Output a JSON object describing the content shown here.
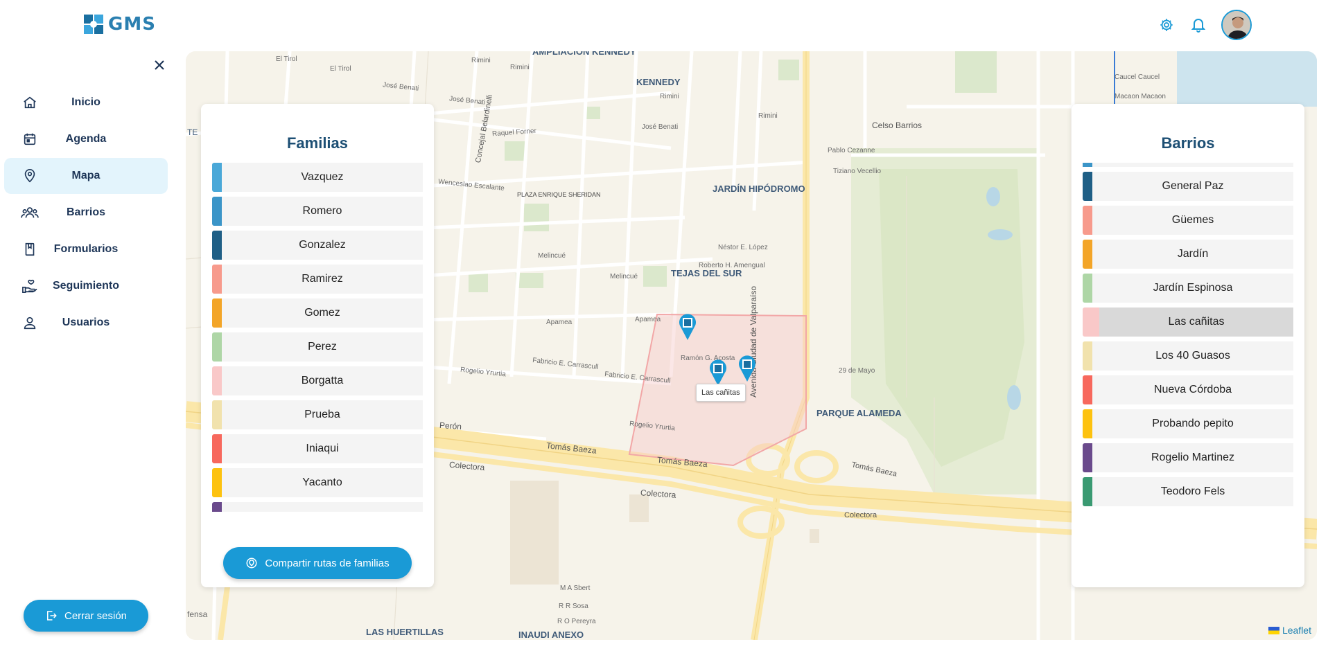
{
  "header": {
    "logo_text": "GMS",
    "settings_icon": "gear-icon",
    "notifications_icon": "bell-icon"
  },
  "sidebar": {
    "items": [
      {
        "label": "Inicio",
        "icon": "home-icon",
        "active": false
      },
      {
        "label": "Agenda",
        "icon": "calendar-icon",
        "active": false
      },
      {
        "label": "Mapa",
        "icon": "map-pin-icon",
        "active": true
      },
      {
        "label": "Barrios",
        "icon": "people-icon",
        "active": false
      },
      {
        "label": "Formularios",
        "icon": "form-icon",
        "active": false
      },
      {
        "label": "Seguimiento",
        "icon": "hand-heart-icon",
        "active": false
      },
      {
        "label": "Usuarios",
        "icon": "user-icon",
        "active": false
      }
    ],
    "logout_label": "Cerrar sesión"
  },
  "map": {
    "labels": {
      "ampliacion_kennedy": "AMPLIACIÓN KENNEDY",
      "kennedy": "KENNEDY",
      "jardin_hipodromo": "JARDÍN HIPÓDROMO",
      "tejas_del_sur": "TEJAS DEL SUR",
      "parque_alameda": "PARQUE ALAMEDA",
      "las_huertillas": "LAS HUERTILLAS",
      "inaudi_anexo": "INAUDI ANEXO",
      "plaza": "PLAZA ENRIQUE SHERIDAN",
      "celso_barrios": "Celso Barrios",
      "tomas_baeza": "Tomás Baeza",
      "colectora": "Colectora",
      "avenida": "Avenida Ciudad de Valparaíso",
      "peron": "Perón",
      "rimini": "Rimini",
      "jose_benati": "José Benati",
      "raquel_forner": "Raquel Forner",
      "wenceslao": "Wenceslao Escalante",
      "melincue": "Melincué",
      "apamea": "Apamea",
      "rogelio_yrurtia": "Rogelio Yrurtia",
      "fabricio": "Fabricio E. Carrascull",
      "ramon_acosta": "Ramón G. Acosta",
      "nestor_lopez": "Néstor E. López",
      "roberto_amengual": "Roberto H. Amengual",
      "pablo_cezanne": "Pablo Cezanne",
      "tiziano_vecellio": "Tiziano Vecellio",
      "mayo": "29 de Mayo",
      "caucel": "Caucel Caucel",
      "macaon": "Macaon Macaon",
      "el_tirol": "El Tirol",
      "concejal": "Concejal Belardinelli",
      "sbert": "M A Sbert",
      "sosa": "R R Sosa",
      "pereyra": "R O Pereyra",
      "fensa": "fensa",
      "te": "TE"
    },
    "tooltip": "Las cañitas",
    "attribution": "Leaflet"
  },
  "familias": {
    "title": "Familias",
    "items": [
      {
        "label": "Vazquez",
        "color": "#4aa8d8"
      },
      {
        "label": "Romero",
        "color": "#3b95c8"
      },
      {
        "label": "Gonzalez",
        "color": "#1f5f86"
      },
      {
        "label": "Ramirez",
        "color": "#f79a8c"
      },
      {
        "label": "Gomez",
        "color": "#f3a528"
      },
      {
        "label": "Perez",
        "color": "#aed6a6"
      },
      {
        "label": "Borgatta",
        "color": "#f9c8c8"
      },
      {
        "label": "Prueba",
        "color": "#f1e2ad"
      },
      {
        "label": "Iniaqui",
        "color": "#f7685d"
      },
      {
        "label": "Yacanto",
        "color": "#fdc20f"
      }
    ],
    "share_button": "Compartir rutas de familias"
  },
  "barrios": {
    "title": "Barrios",
    "items": [
      {
        "label": "General Paz",
        "color": "#1f5f86",
        "selected": false
      },
      {
        "label": "Güemes",
        "color": "#f79a8c",
        "selected": false
      },
      {
        "label": "Jardín",
        "color": "#f3a528",
        "selected": false
      },
      {
        "label": "Jardín Espinosa",
        "color": "#aed6a6",
        "selected": false
      },
      {
        "label": "Las cañitas",
        "color": "#f9c8c8",
        "selected": true
      },
      {
        "label": "Los 40 Guasos",
        "color": "#f1e2ad",
        "selected": false
      },
      {
        "label": "Nueva Córdoba",
        "color": "#f7685d",
        "selected": false
      },
      {
        "label": "Probando pepito",
        "color": "#fdc20f",
        "selected": false
      },
      {
        "label": "Rogelio Martinez",
        "color": "#6a4a8c",
        "selected": false
      },
      {
        "label": "Teodoro Fels",
        "color": "#3a9a72",
        "selected": false
      }
    ]
  }
}
